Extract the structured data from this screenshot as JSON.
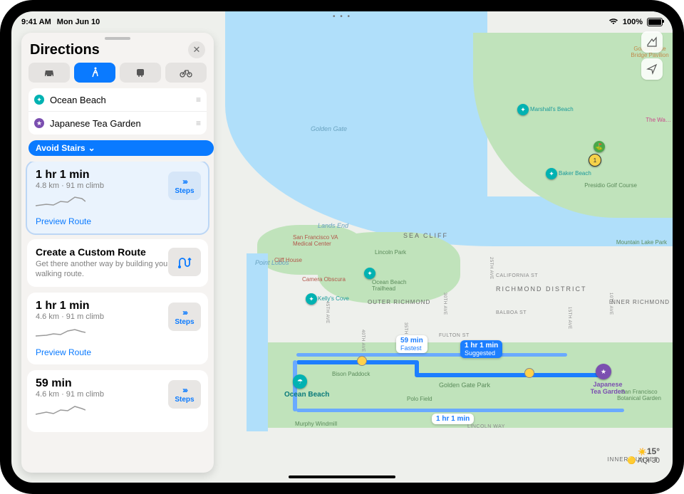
{
  "status": {
    "time": "9:41 AM",
    "date": "Mon Jun 10",
    "wifi": "wifi-icon",
    "battery_pct": "100%"
  },
  "paging_dots": "• • •",
  "sidebar": {
    "title": "Directions",
    "modes": [
      "car",
      "walk",
      "transit",
      "bike"
    ],
    "active_mode": 1,
    "origin": "Ocean Beach",
    "destination": "Japanese Tea Garden",
    "filter_chip": "Avoid Stairs",
    "routes": [
      {
        "time": "1 hr 1 min",
        "sub": "4.8 km · 91 m climb",
        "preview": "Preview Route",
        "steps": "Steps",
        "selected": true
      },
      {
        "time": "1 hr 1 min",
        "sub": "4.6 km · 91 m climb",
        "preview": "Preview Route",
        "steps": "Steps",
        "selected": false
      },
      {
        "time": "59 min",
        "sub": "4.6 km · 91 m climb",
        "preview": "Preview Route",
        "steps": "Steps",
        "selected": false
      }
    ],
    "custom": {
      "title": "Create a Custom Route",
      "desc": "Get there another way by building your own walking route."
    }
  },
  "callouts": {
    "fastest": {
      "time": "59 min",
      "tag": "Fastest"
    },
    "suggested": {
      "time": "1 hr 1 min",
      "tag": "Suggested"
    },
    "alt": "1 hr 1 min"
  },
  "map": {
    "origin_label": "Ocean Beach",
    "dest_label": "Japanese\nTea Garden",
    "labels": {
      "golden_gate": "Golden Gate",
      "lands_end": "Lands End",
      "point_lobos": "Point Lobos",
      "sea_cliff": "SEA CLIFF",
      "richmond": "RICHMOND DISTRICT",
      "outer_richmond": "OUTER RICHMOND",
      "inner_richmond": "INNER RICHMOND",
      "inner_sunset": "INNER SUNSET",
      "california": "CALIFORNIA ST",
      "balboa": "BALBOA ST",
      "fulton": "FULTON ST",
      "lincoln": "LINCOLN WAY",
      "av45": "45TH AVE",
      "av40": "40TH AVE",
      "av35": "35TH AVE",
      "av30": "30TH AVE",
      "av25": "25TH AVE",
      "av15": "15TH AVE",
      "av10": "10TH AVE",
      "ggp": "Golden Gate Park",
      "polo": "Polo Field",
      "bison": "Bison Paddock",
      "murphy": "Murphy Windmill",
      "lincoln_park": "Lincoln Park",
      "presidio_golf": "Presidio Golf Course",
      "sf_va": "San Francisco VA Medical Center",
      "botanical": "San Francisco Botanical Garden",
      "obscura": "Camera Obscura",
      "cliff": "Cliff House",
      "ob_trail": "Ocean Beach Trailhead",
      "kellys": "Kelly's Cove",
      "baker": "Baker Beach",
      "marshalls": "Marshall's Beach",
      "ggbp": "Golden Gate Bridge Pavilion",
      "mt_lake": "Mountain Lake Park",
      "wa": "The Wa…"
    }
  },
  "weather": {
    "temp": "15°",
    "aqi": "AQI 30"
  }
}
